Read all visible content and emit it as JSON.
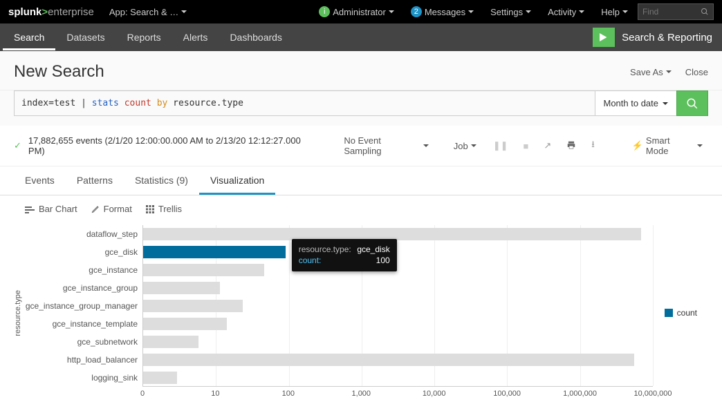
{
  "global": {
    "logo_brand": "splunk",
    "logo_gt": ">",
    "logo_product": "enterprise",
    "app_label": "App: Search & …",
    "admin_label": "Administrator",
    "messages_label": "Messages",
    "messages_count": "2",
    "settings_label": "Settings",
    "activity_label": "Activity",
    "help_label": "Help",
    "find_placeholder": "Find"
  },
  "appnav": {
    "items": [
      "Search",
      "Datasets",
      "Reports",
      "Alerts",
      "Dashboards"
    ],
    "active_index": 0,
    "brand_label": "Search & Reporting"
  },
  "page": {
    "title": "New Search",
    "save_as": "Save As",
    "close": "Close"
  },
  "search": {
    "raw": "index=test | stats count by resource.type",
    "seg_index": "index=test ",
    "seg_pipe": "| ",
    "seg_cmd": "stats ",
    "seg_arg": "count ",
    "seg_by": "by ",
    "seg_field": "resource.type",
    "time_label": "Month to date"
  },
  "meta": {
    "events_text": "17,882,655 events (2/1/20 12:00:00.000 AM to 2/13/20 12:12:27.000 PM)",
    "sampling": "No Event Sampling",
    "job": "Job",
    "smart_mode": "Smart Mode"
  },
  "rtabs": {
    "events": "Events",
    "patterns": "Patterns",
    "stats": "Statistics (9)",
    "viz": "Visualization"
  },
  "viztool": {
    "chart_type": "Bar Chart",
    "format": "Format",
    "trellis": "Trellis"
  },
  "chart_data": {
    "type": "bar",
    "orientation": "horizontal",
    "xscale": "log",
    "xlabel": "",
    "ylabel": "resource.type",
    "legend": "count",
    "xticks": [
      "0",
      "10",
      "100",
      "1,000",
      "10,000",
      "100,000",
      "1,000,000",
      "10,000,000"
    ],
    "categories": [
      "dataflow_step",
      "gce_disk",
      "gce_instance",
      "gce_instance_group",
      "gce_instance_group_manager",
      "gce_instance_template",
      "gce_subnetwork",
      "http_load_balancer",
      "logging_sink"
    ],
    "values": [
      10000000,
      100,
      50,
      12,
      25,
      15,
      6,
      8000000,
      3
    ],
    "highlighted_index": 1,
    "tooltip": {
      "type_label": "resource.type:",
      "type_value": "gce_disk",
      "count_label": "count:",
      "count_value": "100"
    }
  }
}
